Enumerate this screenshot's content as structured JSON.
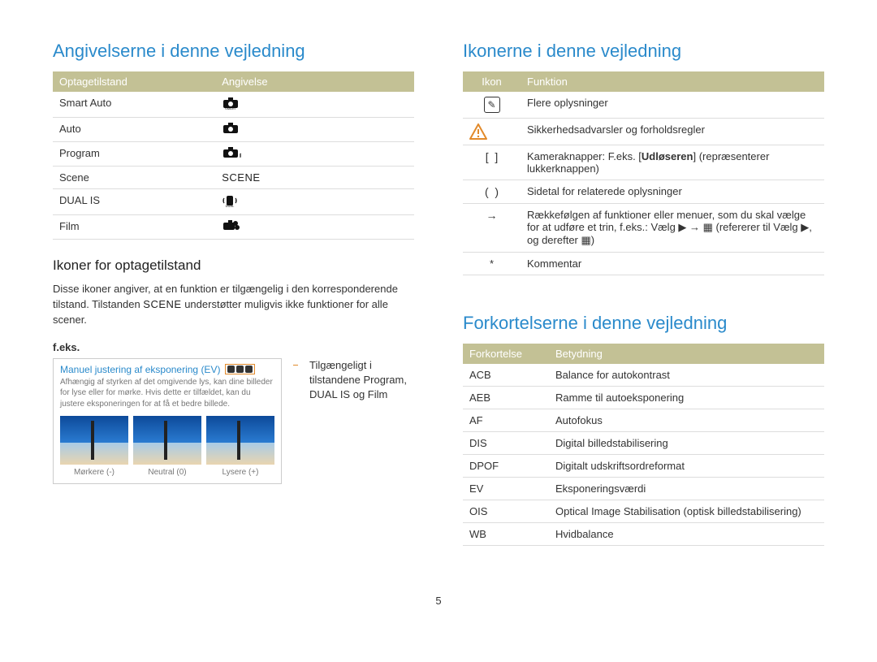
{
  "left": {
    "title": "Angivelserne i denne vejledning",
    "indications_headers": {
      "mode": "Optagetilstand",
      "indication": "Angivelse"
    },
    "indications": [
      {
        "mode": "Smart Auto",
        "icon": "camera-smart"
      },
      {
        "mode": "Auto",
        "icon": "camera"
      },
      {
        "mode": "Program",
        "icon": "camera-p"
      },
      {
        "mode": "Scene",
        "icon": "scene-text"
      },
      {
        "mode": "DUAL IS",
        "icon": "dual-is"
      },
      {
        "mode": "Film",
        "icon": "film"
      }
    ],
    "modeicons_heading": "Ikoner for optagetilstand",
    "modeicons_para": "Disse ikoner angiver, at en funktion er tilgængelig i den korresponderende tilstand. Tilstanden SCENE understøtter muligvis ikke funktioner for alle scener.",
    "feks_label": "f.eks.",
    "example_title": "Manuel justering af eksponering (EV)",
    "example_body": "Afhængig af styrken af det omgivende lys, kan dine billeder for lyse eller for mørke. Hvis dette er tilfældet, kan du justere eksponeringen for at få et bedre billede.",
    "example_thumbs": [
      {
        "cap": "Mørkere (-)"
      },
      {
        "cap": "Neutral (0)"
      },
      {
        "cap": "Lysere (+)"
      }
    ],
    "example_caption": "Tilgængeligt i tilstandene Program, DUAL IS og Film"
  },
  "right_icons": {
    "title": "Ikonerne i denne vejledning",
    "headers": {
      "icon": "Ikon",
      "func": "Funktion"
    },
    "rows": [
      {
        "icon": "note",
        "text": "Flere oplysninger"
      },
      {
        "icon": "warn",
        "text": "Sikkerhedsadvarsler og forholdsregler"
      },
      {
        "icon": "square-brackets",
        "text_html": "Kameraknapper: F.eks. [<b>Udløseren</b>] (repræsenterer lukkerknappen)"
      },
      {
        "icon": "parens",
        "text": "Sidetal for relaterede oplysninger"
      },
      {
        "icon": "arrow",
        "text_html": "Rækkefølgen af funktioner eller menuer, som du skal vælge for at udføre et trin, f.eks.: Vælg ▶ → ▦ (refererer til Vælg ▶, og derefter ▦)"
      },
      {
        "icon": "asterisk",
        "text": "Kommentar"
      }
    ]
  },
  "right_abbr": {
    "title": "Forkortelserne i denne vejledning",
    "headers": {
      "abbr": "Forkortelse",
      "meaning": "Betydning"
    },
    "rows": [
      {
        "abbr": "ACB",
        "meaning": "Balance for autokontrast"
      },
      {
        "abbr": "AEB",
        "meaning": "Ramme til autoeksponering"
      },
      {
        "abbr": "AF",
        "meaning": "Autofokus"
      },
      {
        "abbr": "DIS",
        "meaning": "Digital billedstabilisering"
      },
      {
        "abbr": "DPOF",
        "meaning": "Digitalt udskriftsordreformat"
      },
      {
        "abbr": "EV",
        "meaning": "Eksponeringsværdi"
      },
      {
        "abbr": "OIS",
        "meaning": "Optical Image Stabilisation (optisk billedstabilisering)"
      },
      {
        "abbr": "WB",
        "meaning": "Hvidbalance"
      }
    ]
  },
  "page_number": "5"
}
